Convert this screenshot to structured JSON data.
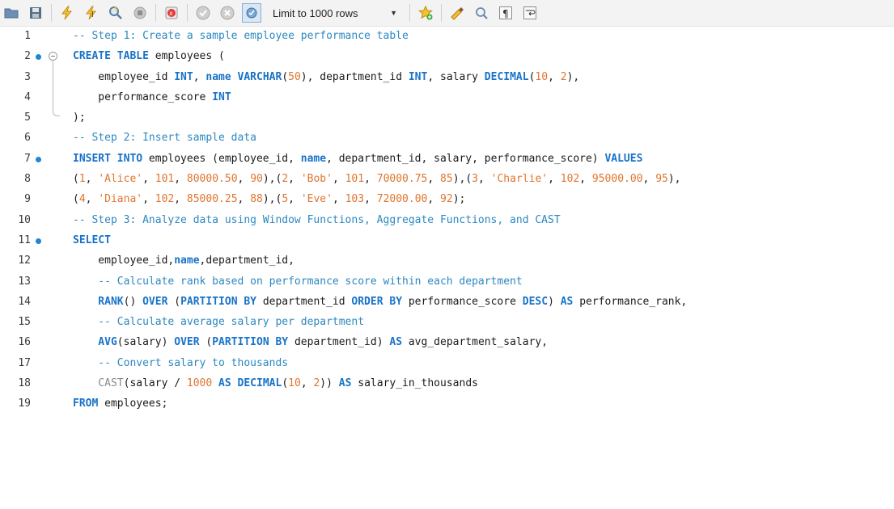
{
  "toolbar": {
    "limit_label": "Limit to 1000 rows",
    "icons": [
      "open-folder-icon",
      "save-icon",
      "execute-icon",
      "execute-current-icon",
      "explain-icon",
      "stop-icon",
      "toggle-continue-icon",
      "commit-icon",
      "rollback-icon",
      "autocommit-icon",
      "add-snippet-icon",
      "beautify-icon",
      "find-icon",
      "invisible-chars-icon",
      "word-wrap-icon"
    ]
  },
  "editor": {
    "lines": [
      {
        "num": "1",
        "tokens": [
          {
            "t": "c",
            "v": "-- Step 1: Create a sample employee performance table"
          }
        ]
      },
      {
        "num": "2",
        "tokens": [
          {
            "t": "k",
            "v": "CREATE TABLE"
          },
          {
            "t": "p",
            "v": " employees ("
          }
        ]
      },
      {
        "num": "3",
        "tokens": [
          {
            "t": "p",
            "v": "    employee_id "
          },
          {
            "t": "k",
            "v": "INT"
          },
          {
            "t": "p",
            "v": ", "
          },
          {
            "t": "k",
            "v": "name"
          },
          {
            "t": "p",
            "v": " "
          },
          {
            "t": "k",
            "v": "VARCHAR"
          },
          {
            "t": "p",
            "v": "("
          },
          {
            "t": "n",
            "v": "50"
          },
          {
            "t": "p",
            "v": "), department_id "
          },
          {
            "t": "k",
            "v": "INT"
          },
          {
            "t": "p",
            "v": ", salary "
          },
          {
            "t": "k",
            "v": "DECIMAL"
          },
          {
            "t": "p",
            "v": "("
          },
          {
            "t": "n",
            "v": "10"
          },
          {
            "t": "p",
            "v": ", "
          },
          {
            "t": "n",
            "v": "2"
          },
          {
            "t": "p",
            "v": "),"
          }
        ]
      },
      {
        "num": "4",
        "tokens": [
          {
            "t": "p",
            "v": "    performance_score "
          },
          {
            "t": "k",
            "v": "INT"
          }
        ]
      },
      {
        "num": "5",
        "tokens": [
          {
            "t": "p",
            "v": ");"
          }
        ]
      },
      {
        "num": "6",
        "tokens": [
          {
            "t": "c",
            "v": "-- Step 2: Insert sample data"
          }
        ]
      },
      {
        "num": "7",
        "tokens": [
          {
            "t": "k",
            "v": "INSERT INTO"
          },
          {
            "t": "p",
            "v": " employees (employee_id, "
          },
          {
            "t": "k",
            "v": "name"
          },
          {
            "t": "p",
            "v": ", department_id, salary, performance_score) "
          },
          {
            "t": "k",
            "v": "VALUES"
          }
        ]
      },
      {
        "num": "8",
        "tokens": [
          {
            "t": "p",
            "v": "("
          },
          {
            "t": "n",
            "v": "1"
          },
          {
            "t": "p",
            "v": ", "
          },
          {
            "t": "s",
            "v": "'Alice'"
          },
          {
            "t": "p",
            "v": ", "
          },
          {
            "t": "n",
            "v": "101"
          },
          {
            "t": "p",
            "v": ", "
          },
          {
            "t": "n",
            "v": "80000.50"
          },
          {
            "t": "p",
            "v": ", "
          },
          {
            "t": "n",
            "v": "90"
          },
          {
            "t": "p",
            "v": "),("
          },
          {
            "t": "n",
            "v": "2"
          },
          {
            "t": "p",
            "v": ", "
          },
          {
            "t": "s",
            "v": "'Bob'"
          },
          {
            "t": "p",
            "v": ", "
          },
          {
            "t": "n",
            "v": "101"
          },
          {
            "t": "p",
            "v": ", "
          },
          {
            "t": "n",
            "v": "70000.75"
          },
          {
            "t": "p",
            "v": ", "
          },
          {
            "t": "n",
            "v": "85"
          },
          {
            "t": "p",
            "v": "),("
          },
          {
            "t": "n",
            "v": "3"
          },
          {
            "t": "p",
            "v": ", "
          },
          {
            "t": "s",
            "v": "'Charlie'"
          },
          {
            "t": "p",
            "v": ", "
          },
          {
            "t": "n",
            "v": "102"
          },
          {
            "t": "p",
            "v": ", "
          },
          {
            "t": "n",
            "v": "95000.00"
          },
          {
            "t": "p",
            "v": ", "
          },
          {
            "t": "n",
            "v": "95"
          },
          {
            "t": "p",
            "v": "),"
          }
        ]
      },
      {
        "num": "9",
        "tokens": [
          {
            "t": "p",
            "v": "("
          },
          {
            "t": "n",
            "v": "4"
          },
          {
            "t": "p",
            "v": ", "
          },
          {
            "t": "s",
            "v": "'Diana'"
          },
          {
            "t": "p",
            "v": ", "
          },
          {
            "t": "n",
            "v": "102"
          },
          {
            "t": "p",
            "v": ", "
          },
          {
            "t": "n",
            "v": "85000.25"
          },
          {
            "t": "p",
            "v": ", "
          },
          {
            "t": "n",
            "v": "88"
          },
          {
            "t": "p",
            "v": "),("
          },
          {
            "t": "n",
            "v": "5"
          },
          {
            "t": "p",
            "v": ", "
          },
          {
            "t": "s",
            "v": "'Eve'"
          },
          {
            "t": "p",
            "v": ", "
          },
          {
            "t": "n",
            "v": "103"
          },
          {
            "t": "p",
            "v": ", "
          },
          {
            "t": "n",
            "v": "72000.00"
          },
          {
            "t": "p",
            "v": ", "
          },
          {
            "t": "n",
            "v": "92"
          },
          {
            "t": "p",
            "v": ");"
          }
        ]
      },
      {
        "num": "10",
        "tokens": [
          {
            "t": "c",
            "v": "-- Step 3: Analyze data using Window Functions, Aggregate Functions, and CAST"
          }
        ]
      },
      {
        "num": "11",
        "tokens": [
          {
            "t": "k",
            "v": "SELECT"
          }
        ]
      },
      {
        "num": "12",
        "tokens": [
          {
            "t": "p",
            "v": "    employee_id,"
          },
          {
            "t": "k",
            "v": "name"
          },
          {
            "t": "p",
            "v": ",department_id,"
          }
        ]
      },
      {
        "num": "13",
        "tokens": [
          {
            "t": "c",
            "v": "    -- Calculate rank based on performance score within each department"
          }
        ]
      },
      {
        "num": "14",
        "tokens": [
          {
            "t": "k",
            "v": "    RANK"
          },
          {
            "t": "p",
            "v": "() "
          },
          {
            "t": "k",
            "v": "OVER"
          },
          {
            "t": "p",
            "v": " ("
          },
          {
            "t": "k",
            "v": "PARTITION BY"
          },
          {
            "t": "p",
            "v": " department_id "
          },
          {
            "t": "k",
            "v": "ORDER BY"
          },
          {
            "t": "p",
            "v": " performance_score "
          },
          {
            "t": "k",
            "v": "DESC"
          },
          {
            "t": "p",
            "v": ") "
          },
          {
            "t": "k",
            "v": "AS"
          },
          {
            "t": "p",
            "v": " performance_rank,"
          }
        ]
      },
      {
        "num": "15",
        "tokens": [
          {
            "t": "c",
            "v": "    -- Calculate average salary per department"
          }
        ]
      },
      {
        "num": "16",
        "tokens": [
          {
            "t": "k",
            "v": "    AVG"
          },
          {
            "t": "p",
            "v": "(salary) "
          },
          {
            "t": "k",
            "v": "OVER"
          },
          {
            "t": "p",
            "v": " ("
          },
          {
            "t": "k",
            "v": "PARTITION BY"
          },
          {
            "t": "p",
            "v": " department_id) "
          },
          {
            "t": "k",
            "v": "AS"
          },
          {
            "t": "p",
            "v": " avg_department_salary,"
          }
        ]
      },
      {
        "num": "17",
        "tokens": [
          {
            "t": "c",
            "v": "    -- Convert salary to thousands"
          }
        ]
      },
      {
        "num": "18",
        "tokens": [
          {
            "t": "f",
            "v": "    CAST"
          },
          {
            "t": "p",
            "v": "(salary / "
          },
          {
            "t": "n",
            "v": "1000"
          },
          {
            "t": "p",
            "v": " "
          },
          {
            "t": "k",
            "v": "AS"
          },
          {
            "t": "p",
            "v": " "
          },
          {
            "t": "k",
            "v": "DECIMAL"
          },
          {
            "t": "p",
            "v": "("
          },
          {
            "t": "n",
            "v": "10"
          },
          {
            "t": "p",
            "v": ", "
          },
          {
            "t": "n",
            "v": "2"
          },
          {
            "t": "p",
            "v": ")) "
          },
          {
            "t": "k",
            "v": "AS"
          },
          {
            "t": "p",
            "v": " salary_in_thousands"
          }
        ]
      },
      {
        "num": "19",
        "tokens": [
          {
            "t": "k",
            "v": "FROM"
          },
          {
            "t": "p",
            "v": " employees;"
          }
        ]
      }
    ],
    "breakpoint_lines": [
      "2",
      "7",
      "11"
    ]
  }
}
